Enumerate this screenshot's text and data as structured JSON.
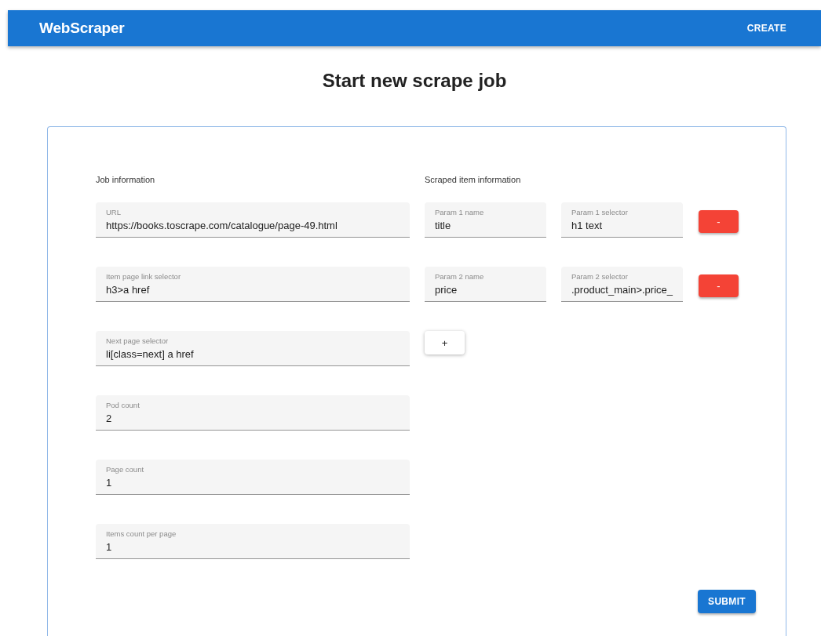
{
  "app_bar": {
    "title": "WebScraper",
    "actions": [
      "CREATE"
    ]
  },
  "heading": "Start new scrape job",
  "job_section": {
    "title": "Job information",
    "fields": [
      {
        "label": "URL",
        "value": "https://books.toscrape.com/catalogue/page-49.html"
      },
      {
        "label": "Item page link selector",
        "value": "h3>a href"
      },
      {
        "label": "Next page selector",
        "value": "li[class=next] a href"
      },
      {
        "label": "Pod count",
        "value": "2"
      },
      {
        "label": "Page count",
        "value": "1"
      },
      {
        "label": "Items count per page",
        "value": "1"
      }
    ]
  },
  "item_section": {
    "title": "Scraped item information",
    "params": [
      {
        "name_label": "Param 1 name",
        "name_value": "title",
        "selector_label": "Param 1 selector",
        "selector_value": "h1 text",
        "remove_label": "-"
      },
      {
        "name_label": "Param 2 name",
        "name_value": "price",
        "selector_label": "Param 2 selector",
        "selector_value": ".product_main>.price_",
        "remove_label": "-"
      }
    ],
    "add_label": "+"
  },
  "submit_label": "SUBMIT"
}
